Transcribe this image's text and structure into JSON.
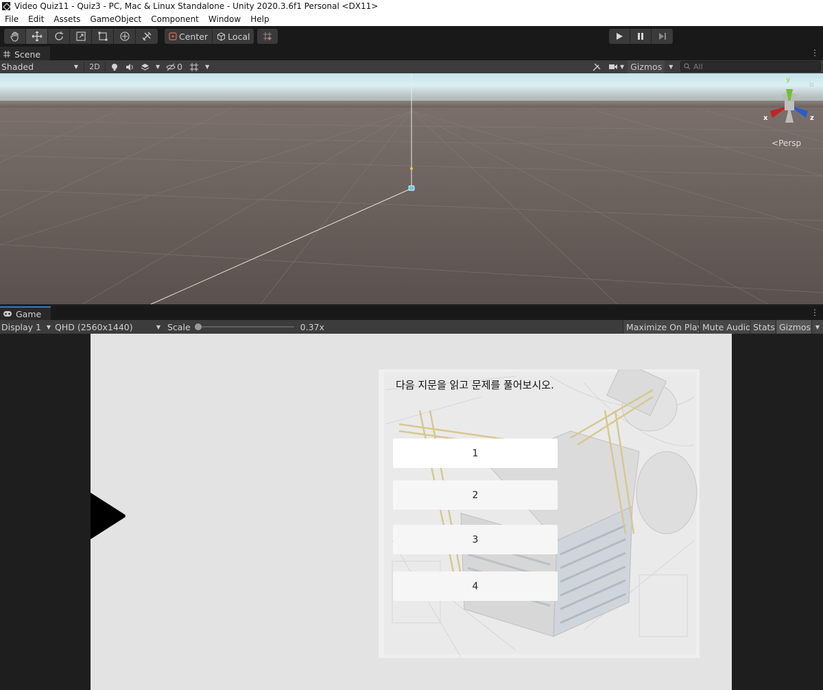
{
  "window": {
    "title": "Video Quiz11 - Quiz3 - PC, Mac & Linux Standalone - Unity 2020.3.6f1 Personal <DX11>"
  },
  "menu": [
    "File",
    "Edit",
    "Assets",
    "GameObject",
    "Component",
    "Window",
    "Help"
  ],
  "toolbar": {
    "tools": [
      "hand-tool-icon",
      "move-tool-icon",
      "rotate-tool-icon",
      "scale-tool-icon",
      "rect-tool-icon",
      "transform-tool-icon",
      "custom-tool-icon"
    ],
    "pivot_label": "Center",
    "space_label": "Local",
    "playback": [
      "play-icon",
      "pause-icon",
      "step-icon"
    ]
  },
  "scene_panel": {
    "tab_label": "Scene",
    "shading_mode": "Shaded",
    "mode_2d": "2D",
    "hidden_count": "0",
    "gizmos_label": "Gizmos",
    "search_placeholder": "All",
    "projection_label": "Persp",
    "axis_labels": {
      "x": "x",
      "y": "y",
      "z": "z"
    }
  },
  "game_panel": {
    "tab_label": "Game",
    "display": "Display 1",
    "resolution": "QHD (2560x1440)",
    "scale_label": "Scale",
    "scale_value": "0.37x",
    "scale_fraction": 0.0,
    "maximize_label": "Maximize On Play",
    "mute_label": "Mute Audio",
    "stats_label": "Stats",
    "gizmos_label": "Gizmos"
  },
  "quiz": {
    "question": "다음 지문을 읽고 문제를 풀어보시오.",
    "answers": [
      "1",
      "2",
      "3",
      "4"
    ]
  },
  "colors": {
    "accent": "#3a79bb",
    "editor_bg": "#1e1e1e",
    "panel_bg": "#3c3c3c",
    "canvas_bg": "#e3e3e3",
    "ground": "#5e5450",
    "sky": "#cde9ef"
  }
}
